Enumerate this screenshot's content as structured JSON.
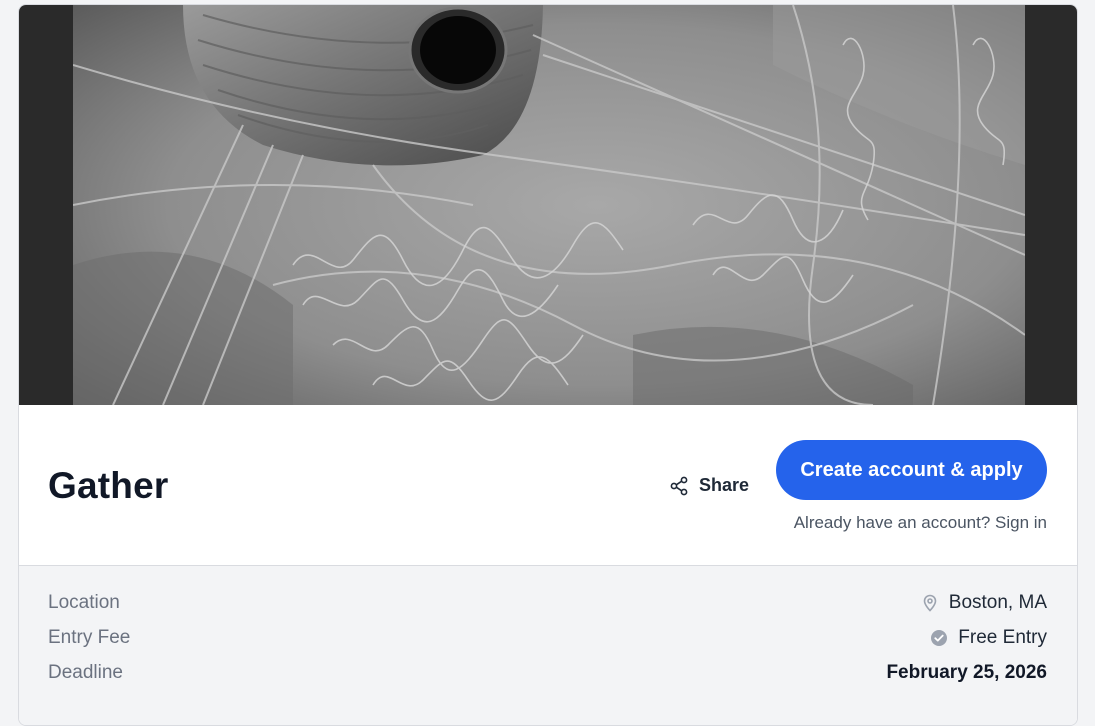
{
  "event": {
    "title": "Gather"
  },
  "hero": {
    "image": "black-and-white-photo-of-thread-spool-and-tangled-string"
  },
  "actions": {
    "share_label": "Share",
    "share_icon": "share-icon",
    "apply_label": "Create account & apply",
    "signin_prefix": "Already have an account? ",
    "signin_link": "Sign in"
  },
  "details": {
    "rows": [
      {
        "label": "Location",
        "value": "Boston, MA",
        "icon": "location-pin-icon"
      },
      {
        "label": "Entry Fee",
        "value": "Free Entry",
        "icon": "check-circle-icon"
      },
      {
        "label": "Deadline",
        "value": "February 25, 2026",
        "icon": ""
      }
    ]
  },
  "colors": {
    "accent": "#2563eb",
    "page_background": "#f3f4f6",
    "details_background": "#f3f4f6",
    "title_text": "#111827",
    "muted_text": "#6b7280"
  }
}
